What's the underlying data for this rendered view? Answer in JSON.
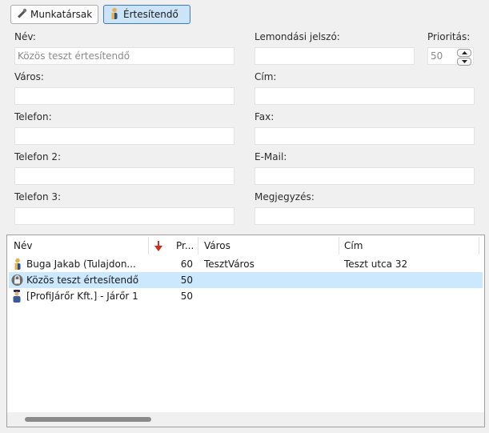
{
  "tabs": [
    {
      "label": "Munkatársak",
      "icon": "wrench-icon",
      "active": false
    },
    {
      "label": "Értesítendő",
      "icon": "person-icon",
      "active": true
    }
  ],
  "form": {
    "nev_label": "Név:",
    "nev_value": "",
    "nev_placeholder": "Közös teszt értesítendő",
    "lemondasi_label": "Lemondási jelszó:",
    "lemondasi_value": "",
    "prioritas_label": "Prioritás:",
    "prioritas_value": "50",
    "varos_label": "Város:",
    "cim_label": "Cím:",
    "telefon_label": "Telefon:",
    "fax_label": "Fax:",
    "telefon2_label": "Telefon 2:",
    "email_label": "E-Mail:",
    "telefon3_label": "Telefon 3:",
    "megjegyzes_label": "Megjegyzés:"
  },
  "list": {
    "columns": [
      "Név",
      "Pr...",
      "Város",
      "Cím"
    ],
    "sort_icon": "sort-down-arrow-icon",
    "rows": [
      {
        "name": "Buga Jakab (Tulajdon...",
        "prio": "60",
        "city": "TesztVáros",
        "address": "Teszt utca 32",
        "icon": "person-icon",
        "selected": false
      },
      {
        "name": "Közös teszt értesítendő",
        "prio": "50",
        "city": "",
        "address": "",
        "icon": "lock-icon",
        "selected": true
      },
      {
        "name": "[ProfiJárőr Kft.] - Járőr 1",
        "prio": "50",
        "city": "",
        "address": "",
        "icon": "guard-icon",
        "selected": false
      }
    ]
  },
  "colors": {
    "accent": "#3d7ac4",
    "selection": "#cce8ff",
    "active_tab": "#cce4f7"
  }
}
